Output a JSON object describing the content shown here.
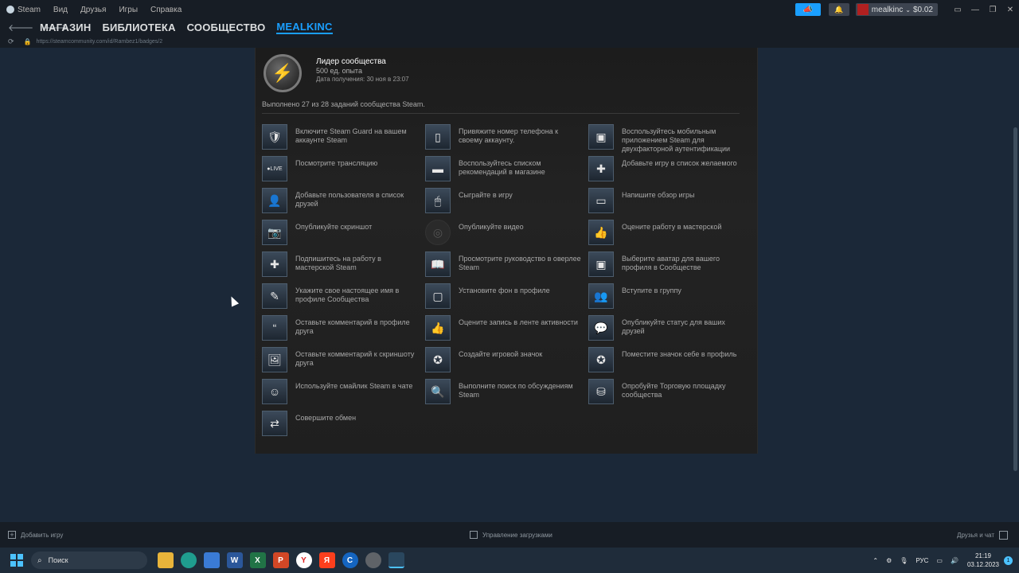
{
  "titlebar": {
    "menu": [
      "Steam",
      "Вид",
      "Друзья",
      "Игры",
      "Справка"
    ],
    "account_name": "mealkinc",
    "balance": "$0.02"
  },
  "nav": {
    "tabs": [
      "МАГАЗИН",
      "БИБЛИОТЕКА",
      "СООБЩЕСТВО",
      "MEALKINC"
    ],
    "url": "https://steamcommunity.com/id/Rambez1/badges/2"
  },
  "badge": {
    "title": "Лидер сообщества",
    "xp": "500 ед. опыта",
    "date": "Дата получения: 30 ноя в 23:07",
    "progress": "Выполнено 27 из 28 заданий сообщества Steam."
  },
  "tasks": [
    {
      "label": "Включите Steam Guard на вашем аккаунте Steam",
      "icon": "shield-icon",
      "glyph": "🛡"
    },
    {
      "label": "Привяжите номер телефона к своему аккаунту.",
      "icon": "phone-icon",
      "glyph": "▯"
    },
    {
      "label": "Воспользуйтесь мобильным приложением Steam для двухфакторной аутентификации",
      "icon": "mobile-auth-icon",
      "glyph": "▣"
    },
    {
      "label": "Посмотрите трансляцию",
      "icon": "live-icon",
      "glyph": "●LIVE"
    },
    {
      "label": "Воспользуйтесь списком рекомендаций в магазине",
      "icon": "queue-icon",
      "glyph": "▬"
    },
    {
      "label": "Добавьте игру в список желаемого",
      "icon": "wishlist-icon",
      "glyph": "✚"
    },
    {
      "label": "Добавьте пользователя в список друзей",
      "icon": "add-friend-icon",
      "glyph": "👤"
    },
    {
      "label": "Сыграйте в игру",
      "icon": "mouse-icon",
      "glyph": "🖱"
    },
    {
      "label": "Напишите обзор игры",
      "icon": "review-icon",
      "glyph": "▭"
    },
    {
      "label": "Опубликуйте скриншот",
      "icon": "camera-icon",
      "glyph": "📷"
    },
    {
      "label": "Опубликуйте видео",
      "icon": "video-icon",
      "glyph": "◎",
      "dim": true
    },
    {
      "label": "Оцените работу в мастерской",
      "icon": "thumbs-up-icon",
      "glyph": "👍"
    },
    {
      "label": "Подпишитесь на работу в мастерской Steam",
      "icon": "subscribe-icon",
      "glyph": "✚"
    },
    {
      "label": "Просмотрите руководство в оверлее Steam",
      "icon": "guide-icon",
      "glyph": "📖"
    },
    {
      "label": "Выберите аватар для вашего профиля в Сообществе",
      "icon": "avatar-icon",
      "glyph": "▣"
    },
    {
      "label": "Укажите свое настоящее имя в профиле Сообщества",
      "icon": "name-icon",
      "glyph": "✎"
    },
    {
      "label": "Установите фон в профиле",
      "icon": "background-icon",
      "glyph": "▢"
    },
    {
      "label": "Вступите в группу",
      "icon": "group-icon",
      "glyph": "👥"
    },
    {
      "label": "Оставьте комментарий в профиле друга",
      "icon": "quote-icon",
      "glyph": "“"
    },
    {
      "label": "Оцените запись в ленте активности",
      "icon": "thumbs-up-icon",
      "glyph": "👍"
    },
    {
      "label": "Опубликуйте статус для ваших друзей",
      "icon": "status-icon",
      "glyph": "💬"
    },
    {
      "label": "Оставьте комментарий к скриншоту друга",
      "icon": "screenshot-comment-icon",
      "glyph": "🖼"
    },
    {
      "label": "Создайте игровой значок",
      "icon": "badge-icon",
      "glyph": "✪"
    },
    {
      "label": "Поместите значок себе в профиль",
      "icon": "featured-badge-icon",
      "glyph": "✪"
    },
    {
      "label": "Используйте смайлик Steam в чате",
      "icon": "emoticon-icon",
      "glyph": "☺"
    },
    {
      "label": "Выполните поиск по обсуждениям Steam",
      "icon": "search-discussions-icon",
      "glyph": "🔍"
    },
    {
      "label": "Опробуйте Торговую площадку сообщества",
      "icon": "market-icon",
      "glyph": "⛁"
    },
    {
      "label": "Совершите обмен",
      "icon": "trade-icon",
      "glyph": "⇄"
    }
  ],
  "bottombar": {
    "add_game": "Добавить игру",
    "downloads": "Управление загрузками",
    "friends": "Друзья и чат"
  },
  "taskbar": {
    "search": "Поиск",
    "lang": "РУС",
    "time": "21:19",
    "date": "03.12.2023",
    "notifications": "1"
  }
}
